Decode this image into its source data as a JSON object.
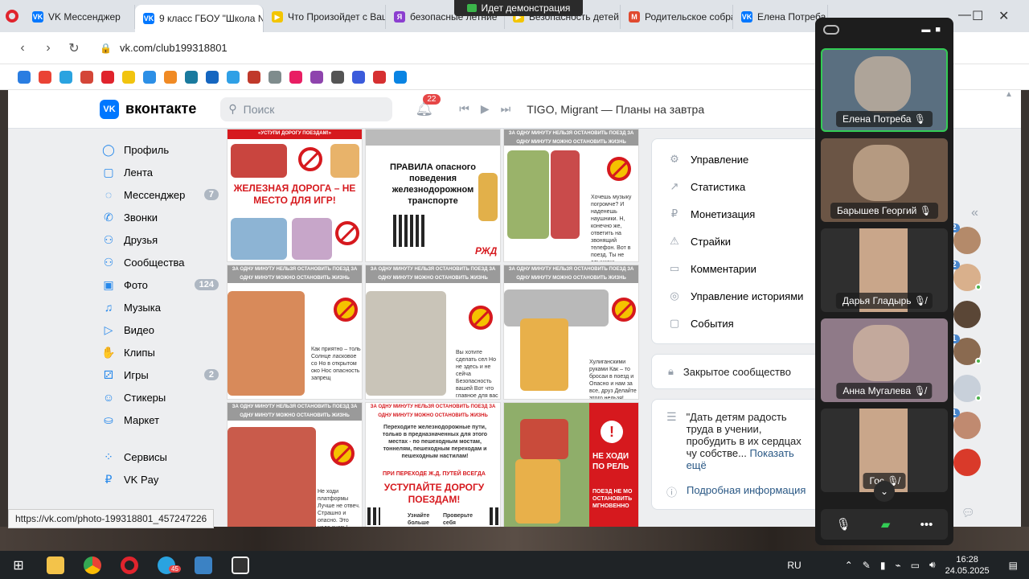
{
  "browser": {
    "tabs": [
      {
        "label": "VK Мессенджер",
        "color": "#0077ff",
        "glyph": "VK"
      },
      {
        "label": "9 класс ГБОУ \"Школа №",
        "color": "#0077ff",
        "glyph": "VK"
      },
      {
        "label": "Что Произойдет с Ваш",
        "color": "#f3c500",
        "glyph": "▶"
      },
      {
        "label": "безопасные летние",
        "color": "#8c3fd0",
        "glyph": "Я"
      },
      {
        "label": "Безопасность детей",
        "color": "#f3c500",
        "glyph": "▶"
      },
      {
        "label": "Родительское собран",
        "color": "#e04a2f",
        "glyph": "M"
      },
      {
        "label": "Елена Потреба",
        "color": "#0077ff",
        "glyph": "VK"
      }
    ],
    "url": "vk.com/club199318801",
    "demo_banner": "Идет демонстрация",
    "status_url": "https://vk.com/photo-199318801_457247226"
  },
  "vk": {
    "logo_text": "вконтакте",
    "logo_glyph": "VK",
    "search_placeholder": "Поиск",
    "notifications": "22",
    "now_playing": "TIGO, Migrant — Планы на завтра",
    "sidebar": [
      {
        "label": "Профиль",
        "icon": "user-icon",
        "glyph": "◯",
        "count": ""
      },
      {
        "label": "Лента",
        "icon": "feed-icon",
        "glyph": "▢",
        "count": ""
      },
      {
        "label": "Мессенджер",
        "icon": "message-icon",
        "glyph": "◌",
        "count": "7"
      },
      {
        "label": "Звонки",
        "icon": "phone-icon",
        "glyph": "✆",
        "count": ""
      },
      {
        "label": "Друзья",
        "icon": "friends-icon",
        "glyph": "⚇",
        "count": ""
      },
      {
        "label": "Сообщества",
        "icon": "communities-icon",
        "glyph": "⚇",
        "count": ""
      },
      {
        "label": "Фото",
        "icon": "photo-icon",
        "glyph": "▣",
        "count": "124"
      },
      {
        "label": "Музыка",
        "icon": "music-icon",
        "glyph": "♫",
        "count": ""
      },
      {
        "label": "Видео",
        "icon": "video-icon",
        "glyph": "▷",
        "count": ""
      },
      {
        "label": "Клипы",
        "icon": "clips-icon",
        "glyph": "✋",
        "count": ""
      },
      {
        "label": "Игры",
        "icon": "games-icon",
        "glyph": "⚂",
        "count": "2"
      },
      {
        "label": "Стикеры",
        "icon": "stickers-icon",
        "glyph": "☺",
        "count": ""
      },
      {
        "label": "Маркет",
        "icon": "market-icon",
        "glyph": "⛀",
        "count": ""
      }
    ],
    "sidebar_bottom": [
      {
        "label": "Сервисы",
        "icon": "services-icon",
        "glyph": "⁘"
      },
      {
        "label": "VK Pay",
        "icon": "vkpay-icon",
        "glyph": "₽"
      }
    ],
    "manage_menu": [
      {
        "label": "Управление",
        "icon": "gear-icon",
        "glyph": "⚙"
      },
      {
        "label": "Статистика",
        "icon": "chart-icon",
        "glyph": "↗"
      },
      {
        "label": "Монетизация",
        "icon": "ruble-icon",
        "glyph": "₽"
      },
      {
        "label": "Страйки",
        "icon": "warning-icon",
        "glyph": "⚠"
      },
      {
        "label": "Комментарии",
        "icon": "comment-icon",
        "glyph": "▭"
      },
      {
        "label": "Управление историями",
        "icon": "stories-icon",
        "glyph": "◎"
      },
      {
        "label": "События",
        "icon": "events-icon",
        "glyph": "▢"
      }
    ],
    "closed_label": "Закрытое сообщество",
    "about_text": "\"Дать детям радость труда в учении, пробудить в их сердцах чу собстве...",
    "about_more": "Показать ещё",
    "details_link": "Подробная информация",
    "posters": {
      "p1_band": "«УСТУПИ ДОРОГУ ПОЕЗДАМ!»",
      "p1_title": "ЖЕЛЕЗНАЯ ДОРОГА – НЕ МЕСТО ДЛЯ ИГР!",
      "p2_title": "ПРАВИЛА опасного поведения железнодорожном транспорте",
      "p2_logo": "РЖД",
      "band_text": "ЗА ОДНУ МИНУТУ НЕЛЬЗЯ ОСТАНОВИТЬ ПОЕЗД ЗА ОДНУ МИНУТУ МОЖНО ОСТАНОВИТЬ ЖИЗНЬ",
      "p3_note": "Хочешь музыку погромче? И наденешь наушники. Н, конечно же, ответить на звонящий телефон. Вот в поезд. Ты не слышишь Пребывание эти. Безопасность на дороге Для тебя важной всего!",
      "p4_note": "Как приятно – толь Солнце ласковое со Но в открытом око Нос опасность запрещ",
      "p5_note": "Вы хотите сделать сел Но не здесь и не сейча Безопасность вашей Вот что главное для вас",
      "p6_note": "Хулиганскими руками Как – то бросаи в поезд и Опасно и нам за все, друз Делайте этого нельзя!",
      "p7_note": "Не ходи платформы Лучше не отвеч. Страшно и опасно. Это надо знать!",
      "p8_note": "Переходите железнодорожные пути, только в предназначенных для этого местах - по пешеходным мостам, тоннелям, пешеходным переходам и пешеходным настилам!",
      "p8_sub": "ПРИ ПЕРЕХОДЕ Ж.Д. ПУТЕЙ ВСЕГДА",
      "p8_title": "УСТУПАЙТЕ ДОРОГУ ПОЕЗДАМ!",
      "p8_foot1": "Узнайте больше",
      "p8_foot2": "Проверьте себя",
      "p9_title": "НЕ ХОДИ ПО РЕЛЬ",
      "p9_note": "ПОЕЗД НЕ МО ОСТАНОВИТЬ МГНОВЕННО"
    },
    "contacts": [
      {
        "badge": "2",
        "color": "#b48a6a",
        "online": false
      },
      {
        "badge": "2",
        "color": "#d9b08c",
        "online": true
      },
      {
        "badge": "",
        "color": "#5a4636",
        "online": false
      },
      {
        "badge": "1",
        "color": "#8a6a50",
        "online": true
      },
      {
        "badge": "",
        "color": "#c8d0da",
        "online": true
      },
      {
        "badge": "1",
        "color": "#c08a70",
        "online": false
      },
      {
        "badge": "",
        "color": "#d93a2a",
        "online": false
      }
    ]
  },
  "call": {
    "participants": [
      {
        "name": "Елена Потреба",
        "active": true,
        "mic": "on",
        "bg": "#5a6f80"
      },
      {
        "name": "Барышев Георгий",
        "active": false,
        "mic": "on",
        "bg": "#6b5545"
      },
      {
        "name": "Дарья Гладырь",
        "active": false,
        "mic": "off",
        "bg": "#2f2f2f"
      },
      {
        "name": "Анна Мугалева",
        "active": false,
        "mic": "off",
        "bg": "#8f7a88"
      },
      {
        "name": "Гос",
        "active": false,
        "mic": "off",
        "bg": "#2f2f2f"
      }
    ]
  },
  "taskbar": {
    "telegram_badge": "45",
    "lang": "RU",
    "time": "16:28",
    "date": "24.05.2025"
  }
}
